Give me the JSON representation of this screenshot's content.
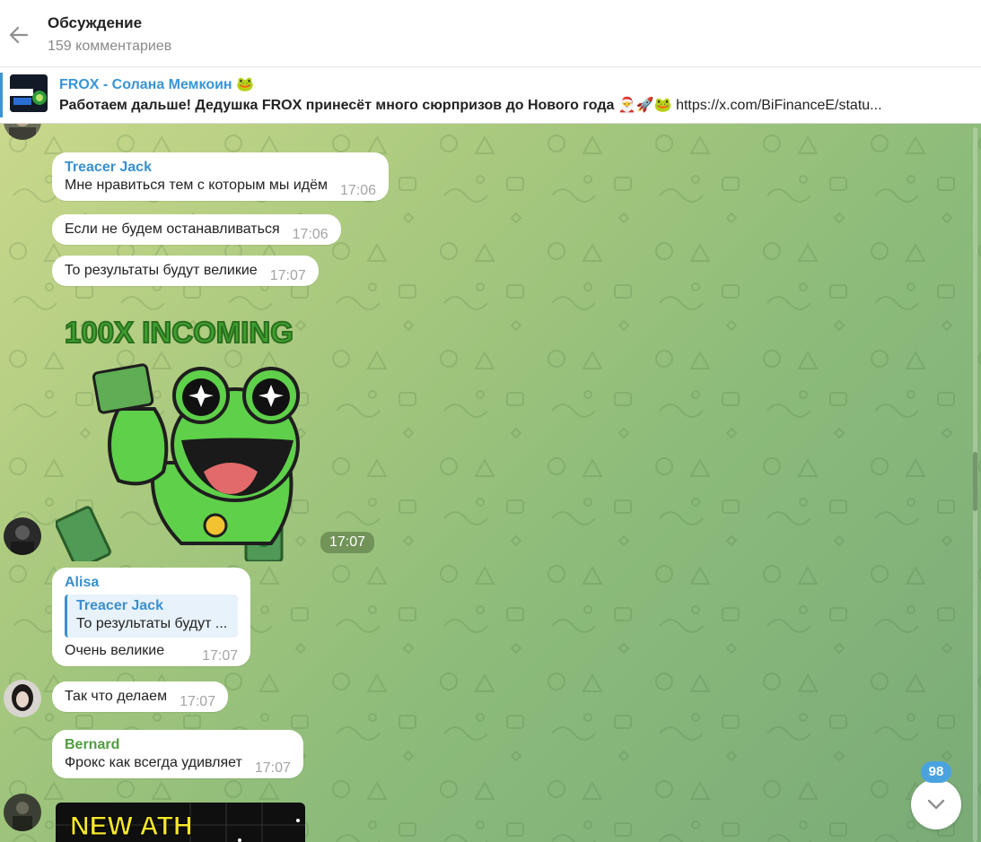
{
  "header": {
    "title": "Обсуждение",
    "subtitle": "159 комментариев"
  },
  "pinned": {
    "title": "FROX - Солана Мемкоин 🐸",
    "text_bold": "Работаем дальше! Дедушка FROX принесёт много сюрпризов до Нового года",
    "text_emoji": " 🎅🚀🐸 ",
    "text_link": "https://x.com/BiFinanceE/statu..."
  },
  "messages": [
    {
      "sender": "Treacer Jack",
      "text": "Мне нравиться тем с которым мы идём",
      "time": "17:06"
    },
    {
      "text": "Если не будем останавливаться",
      "time": "17:06"
    },
    {
      "text": "То результаты будут великие",
      "time": "17:07"
    },
    {
      "sticker_caption": "100X INCOMING",
      "time": "17:07"
    },
    {
      "sender": "Alisa",
      "reply_name": "Treacer Jack",
      "reply_text": "То результаты будут ...",
      "text": "Очень великие",
      "time": "17:07"
    },
    {
      "text": "Так что делаем",
      "time": "17:07"
    },
    {
      "sender": "Bernard",
      "text": "Фрокс как всегда удивляет",
      "time": "17:07"
    },
    {
      "image_caption": "NEW ATH"
    }
  ],
  "unread_count": "98",
  "colors": {
    "accent": "#3a8fcd",
    "bernard": "#4f9c3f",
    "badge": "#4aa3df"
  }
}
